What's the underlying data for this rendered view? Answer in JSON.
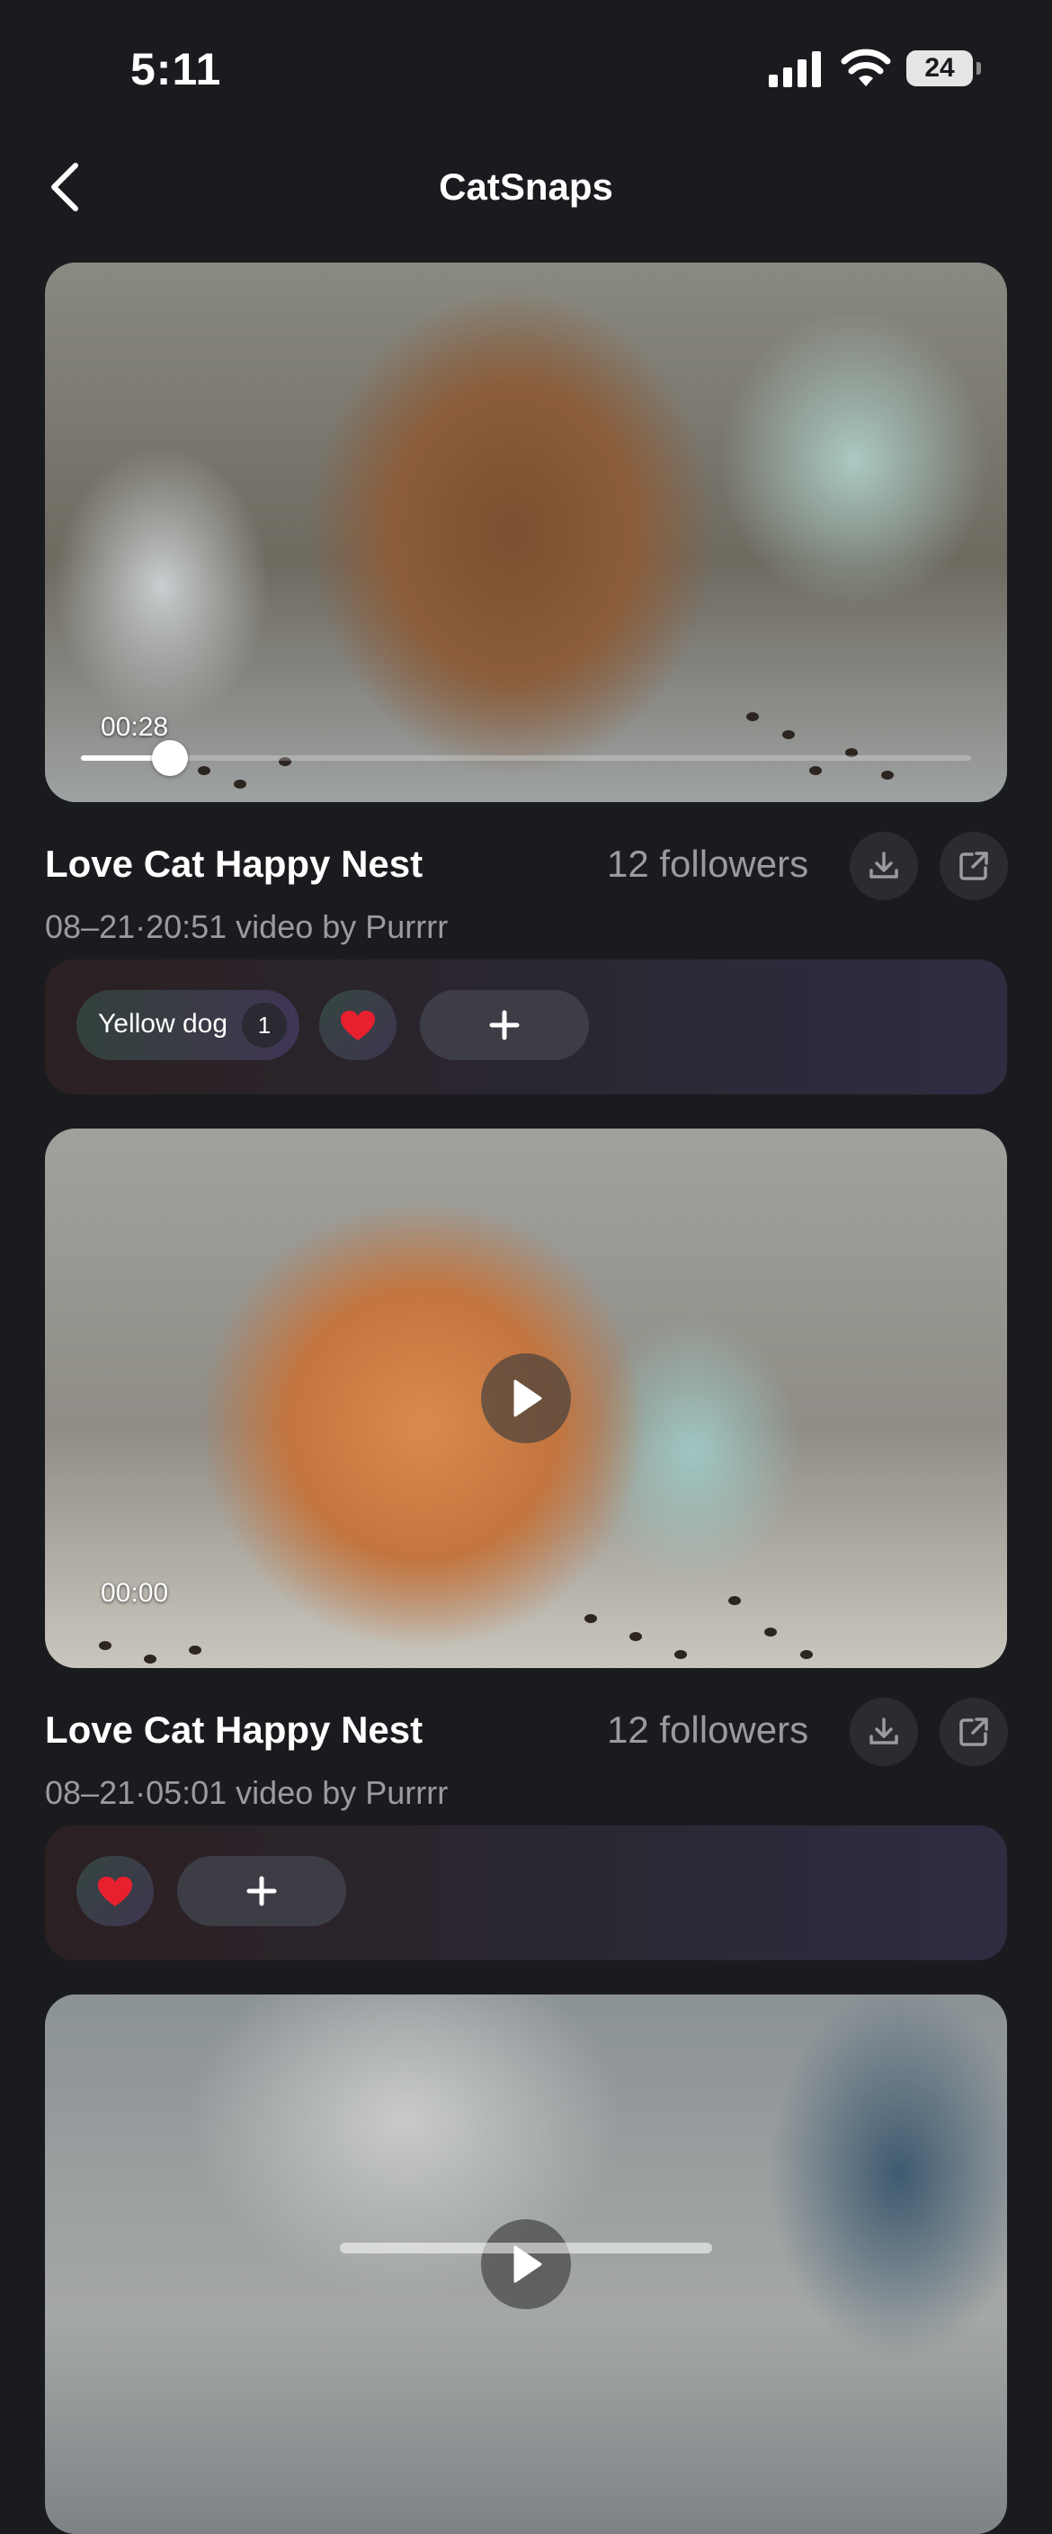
{
  "status_bar": {
    "time": "5:11",
    "battery": "24"
  },
  "nav": {
    "title": "CatSnaps"
  },
  "feed": [
    {
      "video_time": "00:28",
      "playback_progress": 0.1,
      "title": "Love Cat Happy Nest",
      "followers": "12 followers",
      "subtitle": "08–21·20:51 video by Purrrr",
      "tags": [
        {
          "label": "Yellow dog",
          "count": "1"
        }
      ],
      "reaction": "heart"
    },
    {
      "video_time": "00:00",
      "title": "Love Cat Happy Nest",
      "followers": "12 followers",
      "subtitle": "08–21·05:01 video by Purrrr",
      "tags": [],
      "reaction": "heart"
    }
  ],
  "icons": {
    "back": "chevron-left-icon",
    "download": "download-icon",
    "share": "external-link-icon",
    "play": "play-icon",
    "add": "plus-icon",
    "heart": "heart-icon"
  },
  "colors": {
    "background": "#1a1b1f",
    "secondary_text": "#9a9ba0",
    "heart": "#e8202d"
  }
}
